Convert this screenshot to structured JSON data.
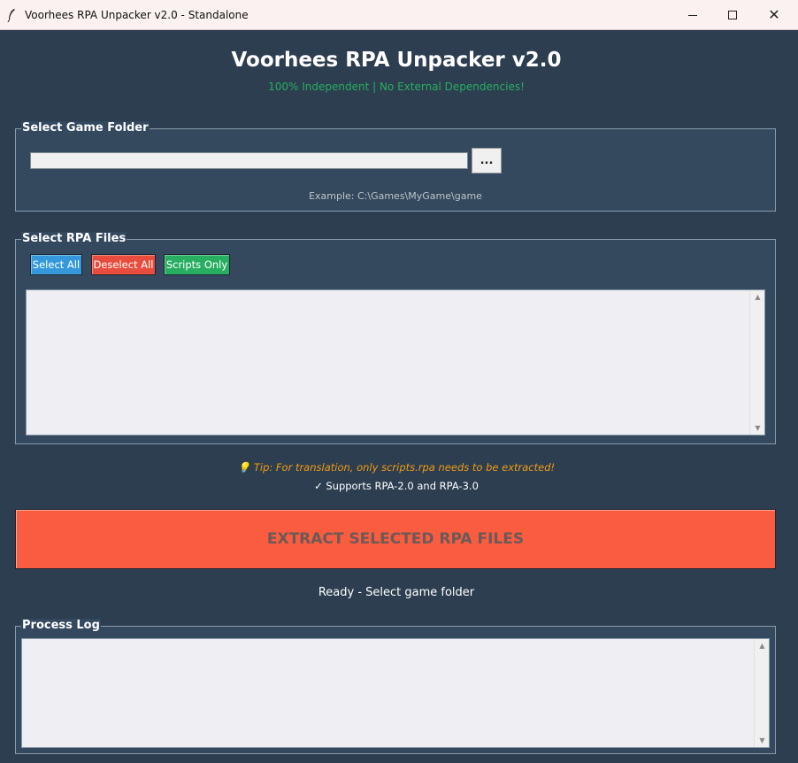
{
  "window": {
    "title": "Voorhees RPA Unpacker v2.0 - Standalone",
    "controls": {
      "minimize": "—",
      "maximize": "☐",
      "close": "✕"
    }
  },
  "header": {
    "title": "Voorhees RPA Unpacker v2.0",
    "subtitle": "100% Independent | No External Dependencies!"
  },
  "folder_group": {
    "legend": "Select Game Folder",
    "path_value": "",
    "browse_label": "...",
    "example": "Example: C:\\Games\\MyGame\\game"
  },
  "rpa_group": {
    "legend": "Select RPA Files",
    "select_all": "Select All",
    "deselect_all": "Deselect All",
    "scripts_only": "Scripts Only",
    "files": []
  },
  "tip": "💡 Tip: For translation, only scripts.rpa needs to be extracted!",
  "supports": "✓ Supports RPA-2.0 and RPA-3.0",
  "extract_button": "EXTRACT SELECTED RPA FILES",
  "status": "Ready - Select game folder",
  "log_group": {
    "legend": "Process Log",
    "content": ""
  },
  "colors": {
    "background": "#2c3e50",
    "panel": "#34495e",
    "select_all": "#3498db",
    "deselect_all": "#e74c3c",
    "scripts_only": "#27ae60",
    "extract": "#f95c3f",
    "subtitle": "#27ae60",
    "tip": "#f39c12"
  },
  "icons": {
    "app": "feather-icon",
    "scroll_up": "arrow-up-icon",
    "scroll_down": "arrow-down-icon"
  }
}
